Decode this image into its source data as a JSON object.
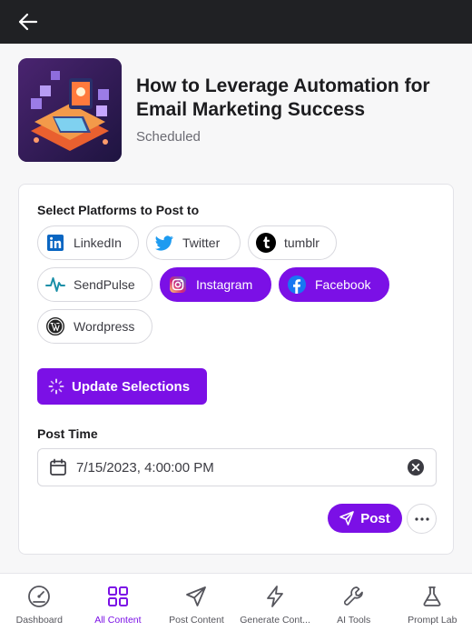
{
  "topbar": {
    "back_icon": "arrow-left-icon"
  },
  "post": {
    "title": "How to Leverage Automation for Email Marketing Success",
    "status": "Scheduled"
  },
  "platforms": {
    "label": "Select Platforms to Post to",
    "items": [
      {
        "name": "LinkedIn",
        "icon": "linkedin-icon",
        "selected": false
      },
      {
        "name": "Twitter",
        "icon": "twitter-icon",
        "selected": false
      },
      {
        "name": "tumblr",
        "icon": "tumblr-icon",
        "selected": false
      },
      {
        "name": "SendPulse",
        "icon": "sendpulse-icon",
        "selected": false
      },
      {
        "name": "Instagram",
        "icon": "instagram-icon",
        "selected": true
      },
      {
        "name": "Facebook",
        "icon": "facebook-icon",
        "selected": true
      },
      {
        "name": "Wordpress",
        "icon": "wordpress-icon",
        "selected": false
      }
    ]
  },
  "update_button": {
    "label": "Update Selections"
  },
  "post_time": {
    "label": "Post Time",
    "value": "7/15/2023, 4:00:00 PM"
  },
  "actions": {
    "post_label": "Post",
    "more_icon": "more-horizontal-icon"
  },
  "nav": {
    "items": [
      {
        "label": "Dashboard",
        "icon": "dashboard-gauge-icon",
        "active": false
      },
      {
        "label": "All Content",
        "icon": "grid-icon",
        "active": true
      },
      {
        "label": "Post Content",
        "icon": "send-icon",
        "active": false
      },
      {
        "label": "Generate Cont...",
        "icon": "lightning-icon",
        "active": false
      },
      {
        "label": "AI Tools",
        "icon": "wrench-icon",
        "active": false
      },
      {
        "label": "Prompt Lab",
        "icon": "flask-icon",
        "active": false
      }
    ]
  },
  "colors": {
    "accent": "#7b10e6",
    "topbar": "#202124",
    "linkedin": "#0a66c2",
    "twitter": "#1d9bf0",
    "facebook": "#1877f2",
    "sendpulse": "#1a8fa8"
  }
}
